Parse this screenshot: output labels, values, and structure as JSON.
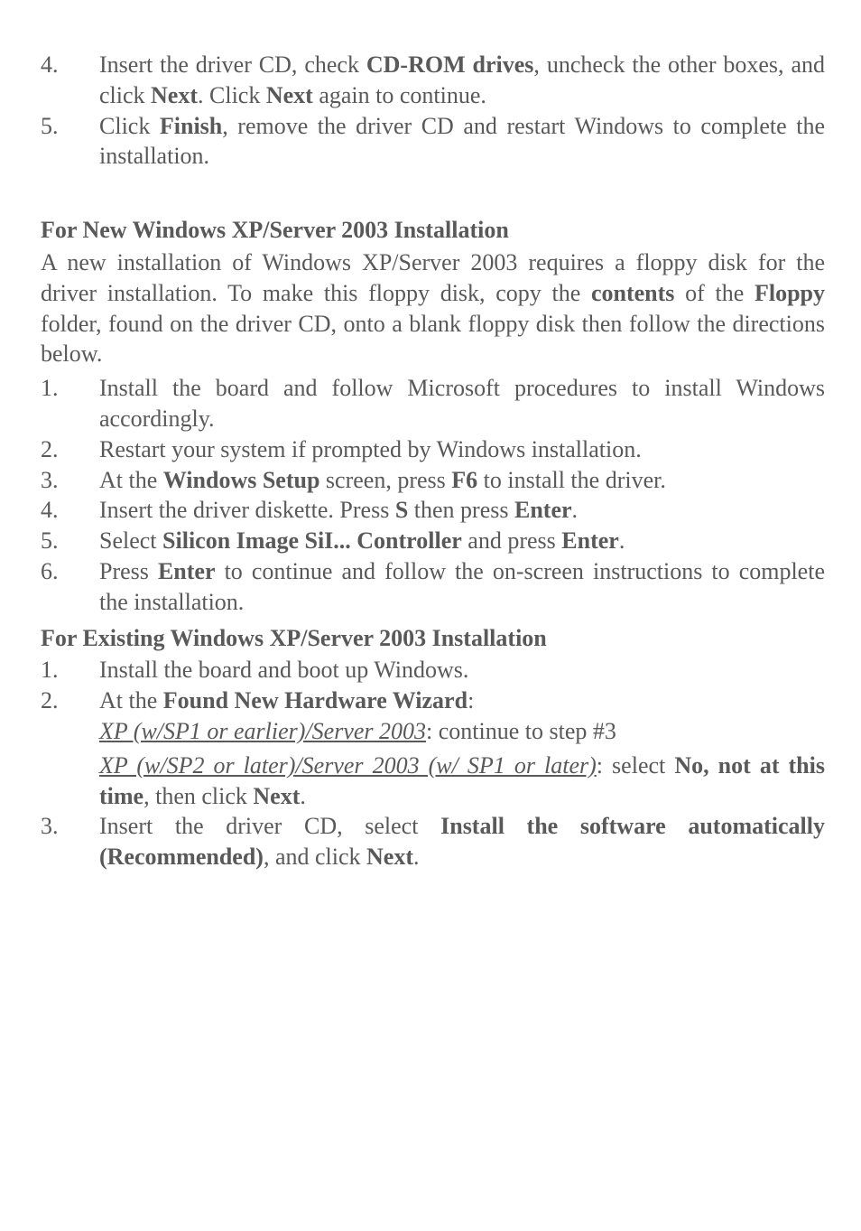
{
  "top_list": [
    {
      "num": "4.",
      "parts": [
        {
          "t": "Insert the driver CD, check "
        },
        {
          "t": "CD-ROM drives",
          "b": true
        },
        {
          "t": ", uncheck the other boxes, and click "
        },
        {
          "t": "Next",
          "b": true
        },
        {
          "t": ".  Click "
        },
        {
          "t": "Next",
          "b": true
        },
        {
          "t": " again to continue."
        }
      ]
    },
    {
      "num": "5.",
      "parts": [
        {
          "t": "Click "
        },
        {
          "t": "Finish",
          "b": true
        },
        {
          "t": ", remove the driver CD and restart Windows to complete the installation."
        }
      ]
    }
  ],
  "heading1": "For New Windows XP/Server 2003 Installation",
  "para1_parts": [
    {
      "t": "A new installation of Windows XP/Server 2003 requires a floppy disk for the driver installation.  To make this floppy disk, copy the "
    },
    {
      "t": "contents",
      "b": true
    },
    {
      "t": " of the "
    },
    {
      "t": "Floppy",
      "b": true
    },
    {
      "t": " folder, found on the driver CD, onto a blank floppy disk then follow the directions below."
    }
  ],
  "list2": [
    {
      "num": "1.",
      "parts": [
        {
          "t": "Install the board and follow Microsoft procedures to install Windows accordingly."
        }
      ]
    },
    {
      "num": "2.",
      "parts": [
        {
          "t": "Restart your system if prompted by Windows installation."
        }
      ]
    },
    {
      "num": "3.",
      "parts": [
        {
          "t": "At the "
        },
        {
          "t": "Windows Setup",
          "b": true
        },
        {
          "t": " screen, press "
        },
        {
          "t": "F6",
          "b": true
        },
        {
          "t": " to install the driver."
        }
      ]
    },
    {
      "num": "4.",
      "parts": [
        {
          "t": "Insert the driver diskette. Press "
        },
        {
          "t": "S",
          "b": true
        },
        {
          "t": " then press "
        },
        {
          "t": "Enter",
          "b": true
        },
        {
          "t": "."
        }
      ]
    },
    {
      "num": "5.",
      "parts": [
        {
          "t": "Select "
        },
        {
          "t": "Silicon Image SiI... Controller",
          "b": true
        },
        {
          "t": " and press "
        },
        {
          "t": "Enter",
          "b": true
        },
        {
          "t": "."
        }
      ]
    },
    {
      "num": "6.",
      "parts": [
        {
          "t": "Press "
        },
        {
          "t": "Enter",
          "b": true
        },
        {
          "t": " to continue and follow the on-screen instructions to complete the installation."
        }
      ]
    }
  ],
  "heading2": "For Existing Windows XP/Server 2003 Installation",
  "list3": [
    {
      "num": "1.",
      "parts": [
        {
          "t": "Install the board and boot up Windows."
        }
      ]
    },
    {
      "num": "2.",
      "parts": [
        {
          "t": "At the "
        },
        {
          "t": "Found New Hardware Wizard",
          "b": true
        },
        {
          "t": ":"
        }
      ],
      "sub": [
        {
          "parts": [
            {
              "t": "XP (w/SP1 or earlier)/Server 2003",
              "u": true
            },
            {
              "t": ": continue to step #3"
            }
          ]
        },
        {
          "parts": [
            {
              "t": "XP (w/SP2 or later)/Server 2003 (w/ SP1 or later)",
              "u": true
            },
            {
              "t": ": select "
            },
            {
              "t": "No, not at this time",
              "b": true
            },
            {
              "t": ", then click "
            },
            {
              "t": "Next",
              "b": true
            },
            {
              "t": "."
            }
          ]
        }
      ]
    },
    {
      "num": "3.",
      "parts": [
        {
          "t": "Insert the driver CD, select "
        },
        {
          "t": "Install the software automatically (Recommended)",
          "b": true
        },
        {
          "t": ", and click "
        },
        {
          "t": "Next",
          "b": true
        },
        {
          "t": "."
        }
      ]
    }
  ]
}
